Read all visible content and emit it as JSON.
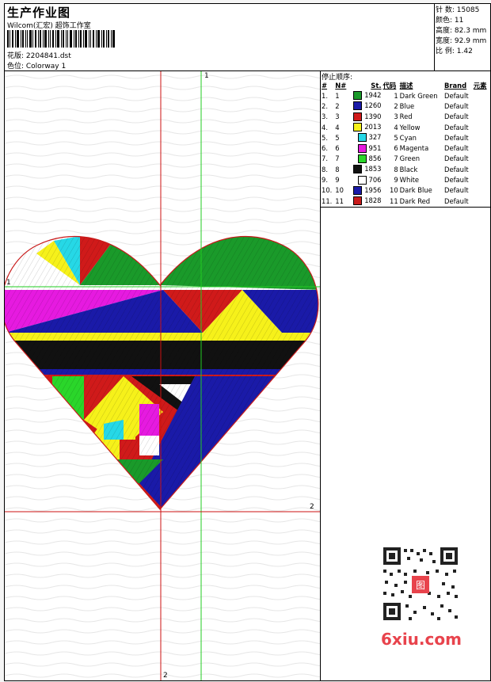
{
  "header": {
    "title": "生产作业图",
    "subtitle": "Wilcom(汇宏) 超饰工作室",
    "design_label": "花版: 2204841.dst",
    "colorway_label": "色位: Colorway 1"
  },
  "stats": {
    "stitches": "针 数: 15085",
    "colors": "颜色: 11",
    "height": "高度: 82.3 mm",
    "width": "宽度: 92.9 mm",
    "scale": "比 例: 1.42"
  },
  "stop_sequence": {
    "title": "停止顺序:",
    "headers": [
      "#",
      "N#",
      "St.",
      "代码",
      "描述",
      "Brand",
      "元素"
    ],
    "rows": [
      {
        "idx": "1.",
        "n": "1",
        "color": "#1a9a2a",
        "st": "1942",
        "code": "1",
        "desc": "Dark Green",
        "brand": "Default"
      },
      {
        "idx": "2.",
        "n": "2",
        "color": "#1a1aa8",
        "st": "1260",
        "code": "2",
        "desc": "Blue",
        "brand": "Default"
      },
      {
        "idx": "3.",
        "n": "3",
        "color": "#d01a1a",
        "st": "1390",
        "code": "3",
        "desc": "Red",
        "brand": "Default"
      },
      {
        "idx": "4.",
        "n": "4",
        "color": "#f6f11a",
        "st": "2013",
        "code": "4",
        "desc": "Yellow",
        "brand": "Default"
      },
      {
        "idx": "5.",
        "n": "5",
        "color": "#26d8e6",
        "st": "327",
        "code": "5",
        "desc": "Cyan",
        "brand": "Default"
      },
      {
        "idx": "6.",
        "n": "6",
        "color": "#e61ae0",
        "st": "951",
        "code": "6",
        "desc": "Magenta",
        "brand": "Default"
      },
      {
        "idx": "7.",
        "n": "7",
        "color": "#2ad62a",
        "st": "856",
        "code": "7",
        "desc": "Green",
        "brand": "Default"
      },
      {
        "idx": "8.",
        "n": "8",
        "color": "#111111",
        "st": "1853",
        "code": "8",
        "desc": "Black",
        "brand": "Default"
      },
      {
        "idx": "9.",
        "n": "9",
        "color": "#ffffff",
        "st": "706",
        "code": "9",
        "desc": "White",
        "brand": "Default"
      },
      {
        "idx": "10.",
        "n": "10",
        "color": "#1a1aa8",
        "st": "1956",
        "code": "10",
        "desc": "Dark Blue",
        "brand": "Default"
      },
      {
        "idx": "11.",
        "n": "11",
        "color": "#c81a1a",
        "st": "1828",
        "code": "11",
        "desc": "Dark Red",
        "brand": "Default"
      }
    ]
  },
  "guides": {
    "label_1": "1",
    "label_2": "2"
  },
  "watermark": {
    "brand_text": "6xiu.com",
    "stamp_text": "图"
  },
  "colors": {
    "guide_green": "#22cc22",
    "guide_red": "#cc1111"
  }
}
